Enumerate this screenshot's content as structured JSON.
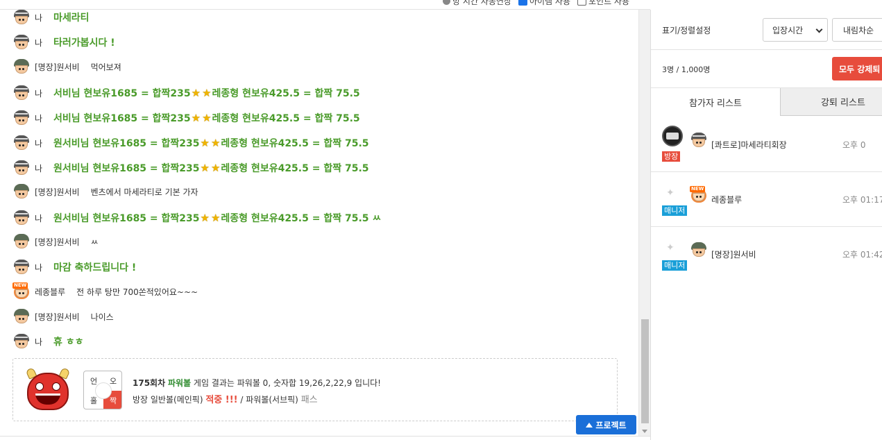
{
  "top_options": {
    "opt1": "방 시간 자동연장",
    "opt2": "아이템 사용",
    "opt3": "포인트 사용"
  },
  "messages": [
    {
      "nick": "나",
      "text": "마세라티",
      "big": true
    },
    {
      "nick": "나",
      "text": "타러가봅시다 !",
      "big": true
    },
    {
      "nick": "[명장]원서비",
      "text": "먹어보져",
      "big": false
    },
    {
      "nick": "나",
      "text_a": "서비님 현보유1685 = 합짝235",
      "text_b": "레종형 현보유425.5 = 합짝 75.5",
      "big": true
    },
    {
      "nick": "나",
      "text_a": "서비님 현보유1685 = 합짝235",
      "text_b": "레종형 현보유425.5 = 합짝 75.5",
      "big": true
    },
    {
      "nick": "나",
      "text_a": "원서비님 현보유1685 = 합짝235",
      "text_b": "레종형 현보유425.5 = 합짝 75.5",
      "big": true
    },
    {
      "nick": "나",
      "text_a": "원서비님 현보유1685 = 합짝235",
      "text_b": "레종형 현보유425.5 = 합짝 75.5",
      "big": true
    },
    {
      "nick": "[명장]원서비",
      "text": "벤츠에서 마세라티로 기본 가자",
      "big": false
    },
    {
      "nick": "나",
      "text_a": "원서비님 현보유1685 = 합짝235",
      "text_b": "레종형 현보유425.5 = 합짝 75.5 ㅆ",
      "big": true
    },
    {
      "nick": "[명장]원서비",
      "text": "ㅆ",
      "big": false
    },
    {
      "nick": "나",
      "text": "마감 축하드립니다 !",
      "big": true
    },
    {
      "nick": "레종블루",
      "text": "전 하루 탕만 700쏜적있어요~~~",
      "big": false
    },
    {
      "nick": "[명장]원서비",
      "text": "나이스",
      "big": false
    },
    {
      "nick": "나",
      "text": "휴 ㅎㅎ",
      "big": true
    }
  ],
  "result": {
    "ball_q1": "언",
    "ball_q2": "오",
    "ball_q3": "홀",
    "ball_q4": "짝",
    "round": "175회차",
    "game": "파워볼",
    "desc": "게임 결과는 파워볼 0, 숫자합 19,26,2,22,9 입니다!",
    "line2_a": "방장 일반볼(메인픽)",
    "hit": "적중 !!!",
    "line2_b": "/ 파워볼(서브픽)",
    "pass": "패스"
  },
  "protect_button": "프로젝트",
  "panel": {
    "sort_label": "표기/정렬설정",
    "sort_select": "입장시간",
    "order_button": "내림차순",
    "count": "3명 / 1,000명",
    "kick_button": "모두 강제퇴",
    "tab_participants": "참가자 리스트",
    "tab_kicked": "강퇴 리스트",
    "members": [
      {
        "role": "방장",
        "name": "[콰트로]마세라티회장",
        "time": "오후 0"
      },
      {
        "role": "매니저",
        "name": "레종블루",
        "time": "오후 01:17"
      },
      {
        "role": "매니저",
        "name": "[명장]원서비",
        "time": "오후 01:42"
      }
    ]
  }
}
